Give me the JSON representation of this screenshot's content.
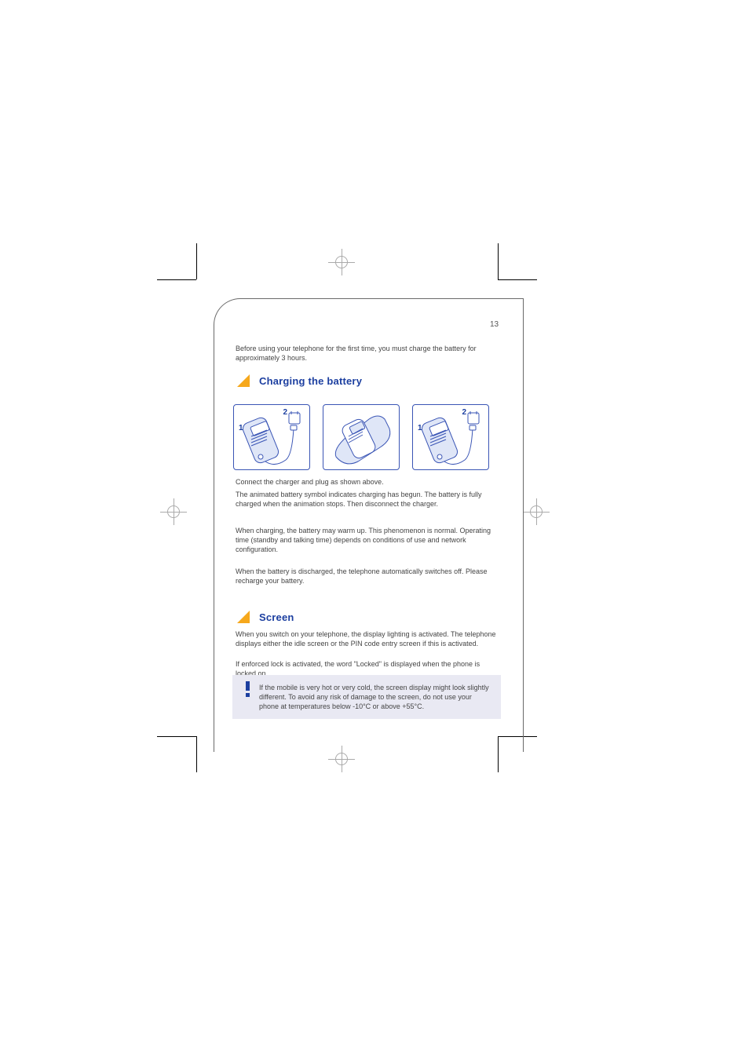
{
  "page_number": "13",
  "section1": {
    "title": "Charging the battery",
    "intro": "Before using your telephone for the first time, you must charge the battery for approximately 3 hours.",
    "diagrams": {
      "left": {
        "label1": "1",
        "label2": "2"
      },
      "right": {
        "label1": "1",
        "label2": "2"
      }
    },
    "body1": "Connect the charger and plug as shown above.",
    "body2": "The animated battery symbol indicates charging has begun. The battery is fully charged when the animation stops. Then disconnect the charger.",
    "body3": "When charging, the battery may warm up. This phenomenon is normal. Operating time (standby and talking time) depends on conditions of use and network configuration.",
    "body4": "When the battery is discharged, the telephone automatically switches off. Please recharge your battery."
  },
  "section2": {
    "title": "Screen",
    "body1": "When you switch on your telephone, the display lighting is activated. The telephone displays either the idle screen or the PIN code entry screen if this is activated.",
    "body2": "If enforced lock is activated, the word \"Locked\" is displayed when the phone is locked on."
  },
  "alert": {
    "text": "If the mobile is very hot or very cold, the screen display might look slightly different. To avoid any risk of damage to the screen, do not use your phone at temperatures below -10°C or above +55°C."
  }
}
